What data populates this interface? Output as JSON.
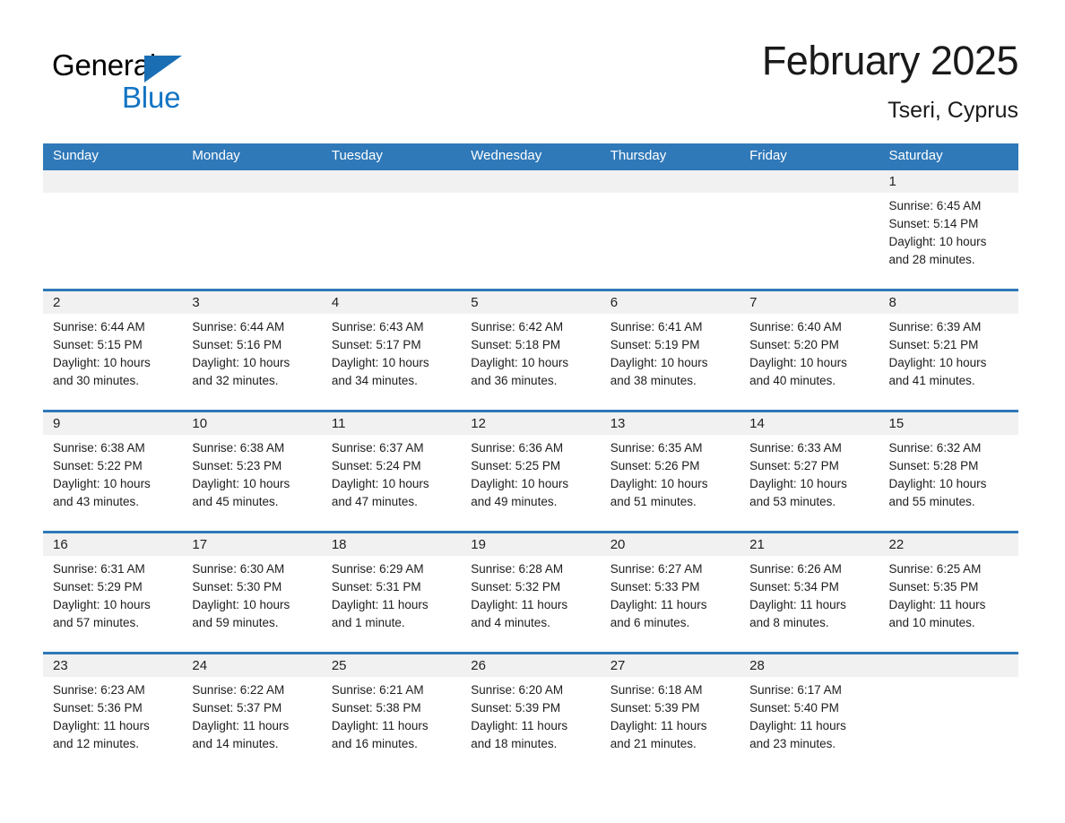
{
  "brand": {
    "name_part1": "General",
    "name_part2": "Blue",
    "logo_icon": "triangle-logo-icon"
  },
  "header": {
    "title": "February 2025",
    "subtitle": "Tseri, Cyprus"
  },
  "calendar": {
    "weekdays": [
      "Sunday",
      "Monday",
      "Tuesday",
      "Wednesday",
      "Thursday",
      "Friday",
      "Saturday"
    ],
    "colors": {
      "header_blue": "#2f79b9",
      "date_band_gray": "#f1f1f1",
      "brand_blue": "#1274c4",
      "logo_blue": "#1a6fb4",
      "text": "#1d1d1d"
    },
    "weeks": [
      [
        {
          "day": "",
          "sunrise": "",
          "sunset": "",
          "daylight1": "",
          "daylight2": ""
        },
        {
          "day": "",
          "sunrise": "",
          "sunset": "",
          "daylight1": "",
          "daylight2": ""
        },
        {
          "day": "",
          "sunrise": "",
          "sunset": "",
          "daylight1": "",
          "daylight2": ""
        },
        {
          "day": "",
          "sunrise": "",
          "sunset": "",
          "daylight1": "",
          "daylight2": ""
        },
        {
          "day": "",
          "sunrise": "",
          "sunset": "",
          "daylight1": "",
          "daylight2": ""
        },
        {
          "day": "",
          "sunrise": "",
          "sunset": "",
          "daylight1": "",
          "daylight2": ""
        },
        {
          "day": "1",
          "sunrise": "Sunrise: 6:45 AM",
          "sunset": "Sunset: 5:14 PM",
          "daylight1": "Daylight: 10 hours",
          "daylight2": "and 28 minutes."
        }
      ],
      [
        {
          "day": "2",
          "sunrise": "Sunrise: 6:44 AM",
          "sunset": "Sunset: 5:15 PM",
          "daylight1": "Daylight: 10 hours",
          "daylight2": "and 30 minutes."
        },
        {
          "day": "3",
          "sunrise": "Sunrise: 6:44 AM",
          "sunset": "Sunset: 5:16 PM",
          "daylight1": "Daylight: 10 hours",
          "daylight2": "and 32 minutes."
        },
        {
          "day": "4",
          "sunrise": "Sunrise: 6:43 AM",
          "sunset": "Sunset: 5:17 PM",
          "daylight1": "Daylight: 10 hours",
          "daylight2": "and 34 minutes."
        },
        {
          "day": "5",
          "sunrise": "Sunrise: 6:42 AM",
          "sunset": "Sunset: 5:18 PM",
          "daylight1": "Daylight: 10 hours",
          "daylight2": "and 36 minutes."
        },
        {
          "day": "6",
          "sunrise": "Sunrise: 6:41 AM",
          "sunset": "Sunset: 5:19 PM",
          "daylight1": "Daylight: 10 hours",
          "daylight2": "and 38 minutes."
        },
        {
          "day": "7",
          "sunrise": "Sunrise: 6:40 AM",
          "sunset": "Sunset: 5:20 PM",
          "daylight1": "Daylight: 10 hours",
          "daylight2": "and 40 minutes."
        },
        {
          "day": "8",
          "sunrise": "Sunrise: 6:39 AM",
          "sunset": "Sunset: 5:21 PM",
          "daylight1": "Daylight: 10 hours",
          "daylight2": "and 41 minutes."
        }
      ],
      [
        {
          "day": "9",
          "sunrise": "Sunrise: 6:38 AM",
          "sunset": "Sunset: 5:22 PM",
          "daylight1": "Daylight: 10 hours",
          "daylight2": "and 43 minutes."
        },
        {
          "day": "10",
          "sunrise": "Sunrise: 6:38 AM",
          "sunset": "Sunset: 5:23 PM",
          "daylight1": "Daylight: 10 hours",
          "daylight2": "and 45 minutes."
        },
        {
          "day": "11",
          "sunrise": "Sunrise: 6:37 AM",
          "sunset": "Sunset: 5:24 PM",
          "daylight1": "Daylight: 10 hours",
          "daylight2": "and 47 minutes."
        },
        {
          "day": "12",
          "sunrise": "Sunrise: 6:36 AM",
          "sunset": "Sunset: 5:25 PM",
          "daylight1": "Daylight: 10 hours",
          "daylight2": "and 49 minutes."
        },
        {
          "day": "13",
          "sunrise": "Sunrise: 6:35 AM",
          "sunset": "Sunset: 5:26 PM",
          "daylight1": "Daylight: 10 hours",
          "daylight2": "and 51 minutes."
        },
        {
          "day": "14",
          "sunrise": "Sunrise: 6:33 AM",
          "sunset": "Sunset: 5:27 PM",
          "daylight1": "Daylight: 10 hours",
          "daylight2": "and 53 minutes."
        },
        {
          "day": "15",
          "sunrise": "Sunrise: 6:32 AM",
          "sunset": "Sunset: 5:28 PM",
          "daylight1": "Daylight: 10 hours",
          "daylight2": "and 55 minutes."
        }
      ],
      [
        {
          "day": "16",
          "sunrise": "Sunrise: 6:31 AM",
          "sunset": "Sunset: 5:29 PM",
          "daylight1": "Daylight: 10 hours",
          "daylight2": "and 57 minutes."
        },
        {
          "day": "17",
          "sunrise": "Sunrise: 6:30 AM",
          "sunset": "Sunset: 5:30 PM",
          "daylight1": "Daylight: 10 hours",
          "daylight2": "and 59 minutes."
        },
        {
          "day": "18",
          "sunrise": "Sunrise: 6:29 AM",
          "sunset": "Sunset: 5:31 PM",
          "daylight1": "Daylight: 11 hours",
          "daylight2": "and 1 minute."
        },
        {
          "day": "19",
          "sunrise": "Sunrise: 6:28 AM",
          "sunset": "Sunset: 5:32 PM",
          "daylight1": "Daylight: 11 hours",
          "daylight2": "and 4 minutes."
        },
        {
          "day": "20",
          "sunrise": "Sunrise: 6:27 AM",
          "sunset": "Sunset: 5:33 PM",
          "daylight1": "Daylight: 11 hours",
          "daylight2": "and 6 minutes."
        },
        {
          "day": "21",
          "sunrise": "Sunrise: 6:26 AM",
          "sunset": "Sunset: 5:34 PM",
          "daylight1": "Daylight: 11 hours",
          "daylight2": "and 8 minutes."
        },
        {
          "day": "22",
          "sunrise": "Sunrise: 6:25 AM",
          "sunset": "Sunset: 5:35 PM",
          "daylight1": "Daylight: 11 hours",
          "daylight2": "and 10 minutes."
        }
      ],
      [
        {
          "day": "23",
          "sunrise": "Sunrise: 6:23 AM",
          "sunset": "Sunset: 5:36 PM",
          "daylight1": "Daylight: 11 hours",
          "daylight2": "and 12 minutes."
        },
        {
          "day": "24",
          "sunrise": "Sunrise: 6:22 AM",
          "sunset": "Sunset: 5:37 PM",
          "daylight1": "Daylight: 11 hours",
          "daylight2": "and 14 minutes."
        },
        {
          "day": "25",
          "sunrise": "Sunrise: 6:21 AM",
          "sunset": "Sunset: 5:38 PM",
          "daylight1": "Daylight: 11 hours",
          "daylight2": "and 16 minutes."
        },
        {
          "day": "26",
          "sunrise": "Sunrise: 6:20 AM",
          "sunset": "Sunset: 5:39 PM",
          "daylight1": "Daylight: 11 hours",
          "daylight2": "and 18 minutes."
        },
        {
          "day": "27",
          "sunrise": "Sunrise: 6:18 AM",
          "sunset": "Sunset: 5:39 PM",
          "daylight1": "Daylight: 11 hours",
          "daylight2": "and 21 minutes."
        },
        {
          "day": "28",
          "sunrise": "Sunrise: 6:17 AM",
          "sunset": "Sunset: 5:40 PM",
          "daylight1": "Daylight: 11 hours",
          "daylight2": "and 23 minutes."
        },
        {
          "day": "",
          "sunrise": "",
          "sunset": "",
          "daylight1": "",
          "daylight2": ""
        }
      ]
    ]
  }
}
